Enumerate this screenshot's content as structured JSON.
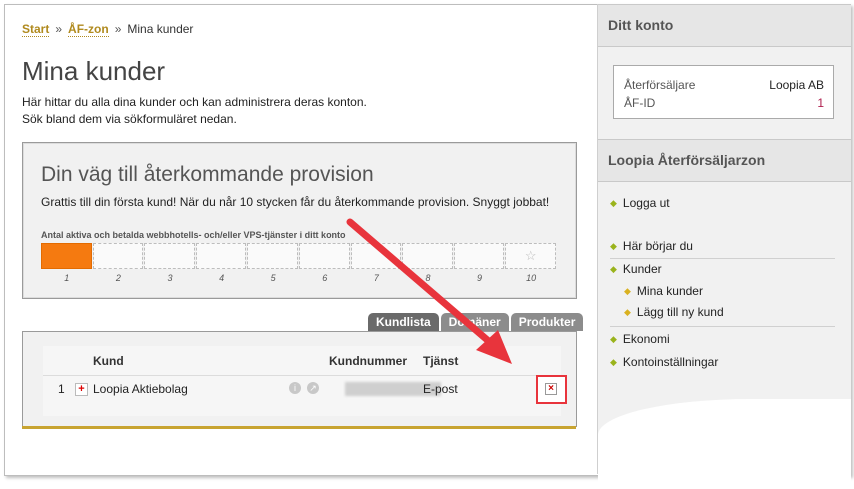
{
  "breadcrumb": {
    "start": "Start",
    "sep1": "»",
    "zone": "ÅF-zon",
    "sep2": "»",
    "current": "Mina kunder"
  },
  "page_title": "Mina kunder",
  "intro": {
    "line1": "Här hittar du alla dina kunder och kan administrera deras konton.",
    "line2": "Sök bland dem via sökformuläret nedan."
  },
  "provision": {
    "title": "Din väg till återkommande provision",
    "message": "Grattis till din första kund! När du når 10 stycken får du återkommande provision. Snyggt jobbat!",
    "label": "Antal aktiva och betalda webbhotells- och/eller VPS-tjänster i ditt konto",
    "progress_filled": 1,
    "numbers": [
      "1",
      "2",
      "3",
      "4",
      "5",
      "6",
      "7",
      "8",
      "9",
      "10"
    ],
    "star_icon": "star-icon"
  },
  "tabs": [
    {
      "label": "Kundlista"
    },
    {
      "label": "Domäner"
    },
    {
      "label": "Produkter"
    }
  ],
  "table": {
    "headers": {
      "kund": "Kund",
      "kundnummer": "Kundnummer",
      "tjanst": "Tjänst"
    },
    "rows": [
      {
        "index": "1",
        "name": "Loopia Aktiebolag",
        "tjanst": "E-post"
      }
    ]
  },
  "sidebar": {
    "account_heading": "Ditt konto",
    "reseller_label": "Återförsäljare",
    "reseller_value": "Loopia AB",
    "afid_label": "ÅF-ID",
    "afid_value": "1",
    "zone_heading": "Loopia Återförsäljarzon",
    "menu": {
      "logout": "Logga ut",
      "start_here": "Här börjar du",
      "customers": "Kunder",
      "my_customers": "Mina kunder",
      "add_customer": "Lägg till ny kund",
      "economy": "Ekonomi",
      "settings": "Kontoinställningar"
    }
  },
  "colors": {
    "accent_gold": "#c8a431",
    "progress_orange": "#f57a10",
    "annotation_red": "#e8343c"
  }
}
